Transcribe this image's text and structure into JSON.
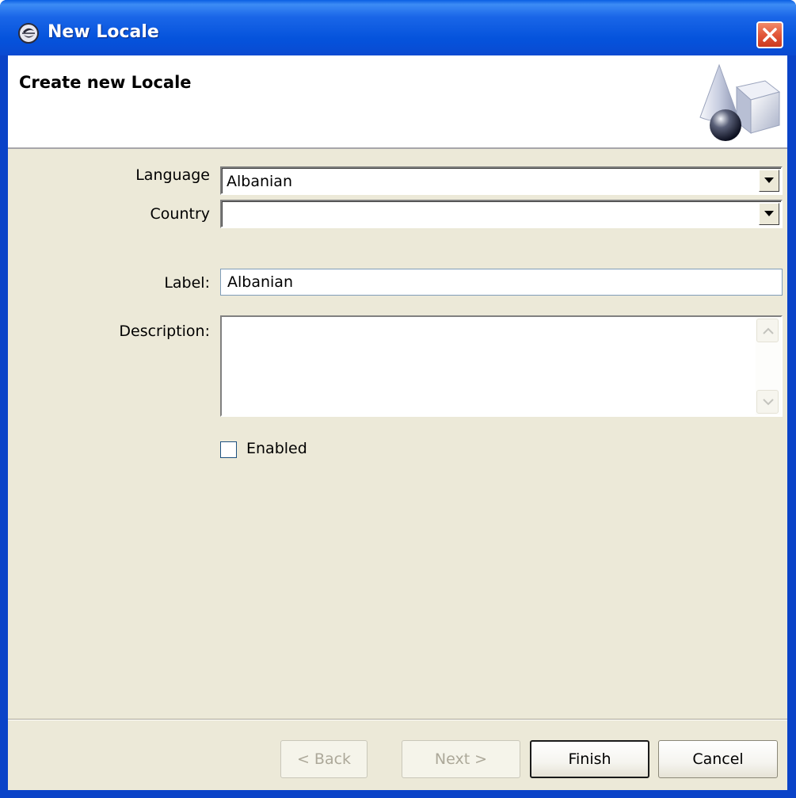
{
  "window": {
    "title": "New Locale",
    "close_icon": "close-icon",
    "app_icon": "eclipse-icon"
  },
  "header": {
    "title": "Create new Locale",
    "graphic": "wizard-shapes-graphic"
  },
  "form": {
    "language_label": "Language",
    "language_value": "Albanian",
    "country_label": "Country",
    "country_value": "",
    "label_label": "Label:",
    "label_value": "Albanian",
    "description_label": "Description:",
    "description_value": "",
    "enabled_label": "Enabled",
    "enabled_checked": false
  },
  "buttons": {
    "back": "< Back",
    "next": "Next >",
    "finish": "Finish",
    "cancel": "Cancel"
  }
}
